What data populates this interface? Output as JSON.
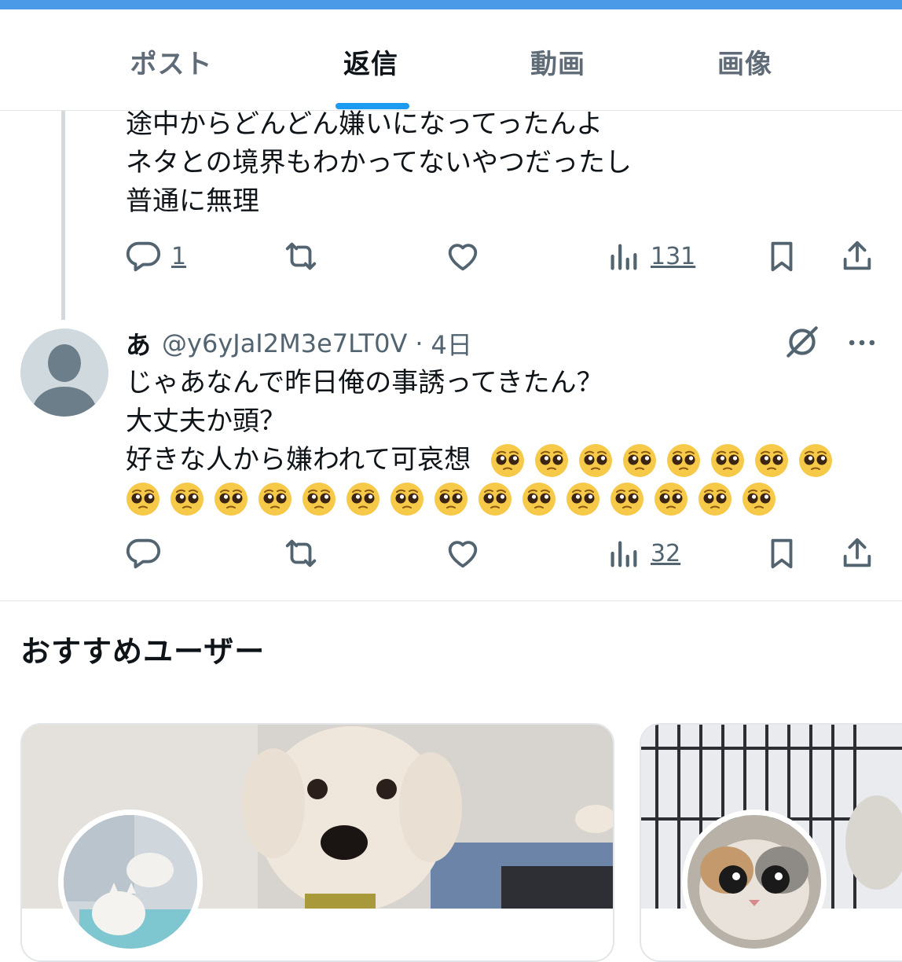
{
  "tabs": [
    {
      "label": "ポスト",
      "active": false
    },
    {
      "label": "返信",
      "active": true
    },
    {
      "label": "動画",
      "active": false
    },
    {
      "label": "画像",
      "active": false
    }
  ],
  "post1": {
    "lines": [
      "途中からどんどん嫌いになってったんよ",
      "ネタとの境界もわかってないやつだったし",
      "普通に無理"
    ],
    "reply_count": "1",
    "view_count": "131"
  },
  "post2": {
    "name": "あ",
    "handle": "@y6yJaI2M3e7LT0V",
    "separator": "·",
    "time": "4日",
    "lines": [
      "じゃあなんで昨日俺の事誘ってきたん？",
      "大丈夫か頭？",
      "好きな人から嫌われて可哀想"
    ],
    "emoji": "pleading-face",
    "emoji_count_line1": 8,
    "emoji_count_line2": 15,
    "view_count": "32"
  },
  "recommend": {
    "title": "おすすめユーザー"
  },
  "colors": {
    "accent": "#1d9bf0",
    "top_bar": "#4a9ae8",
    "icon": "#536471"
  }
}
